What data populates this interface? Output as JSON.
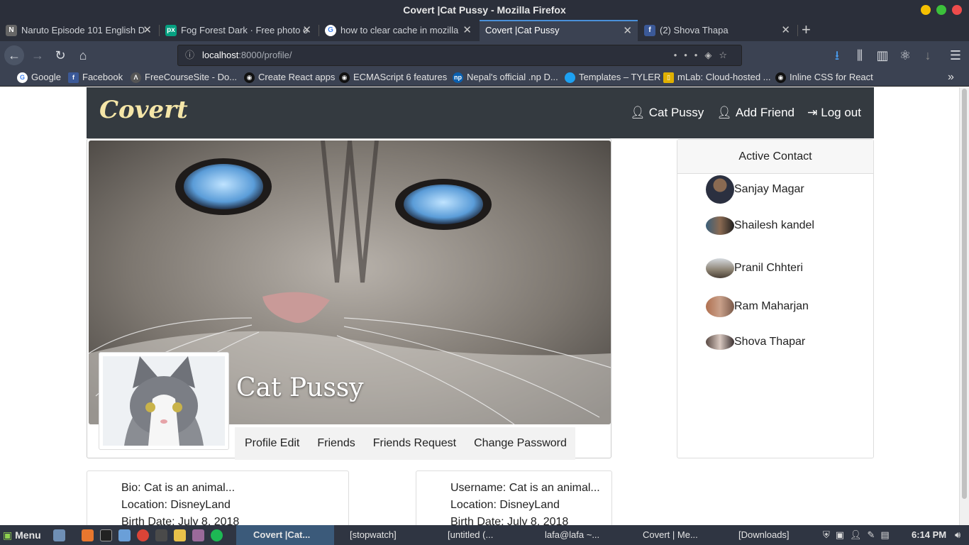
{
  "window": {
    "title": "Covert |Cat Pussy - Mozilla Firefox"
  },
  "tabs": [
    {
      "label": "Naruto Episode 101 English D",
      "icon": "N"
    },
    {
      "label": "Fog Forest Dark · Free photo o",
      "icon": "px"
    },
    {
      "label": "how to clear cache in mozilla",
      "icon": "G"
    },
    {
      "label": "Covert |Cat Pussy",
      "icon": ""
    },
    {
      "label": "(2) Shova Thapa",
      "icon": "f"
    }
  ],
  "url": {
    "host": "localhost",
    "rest": ":8000/profile/"
  },
  "bookmarks": [
    "Google",
    "Facebook",
    "FreeCourseSite - Do...",
    "Create React apps",
    "ECMAScript 6 features",
    "Nepal's official .np D...",
    "Templates – TYLER",
    "mLab: Cloud-hosted ...",
    "Inline CSS for React"
  ],
  "site": {
    "brand": "Covert",
    "nav": {
      "profile": "Cat Pussy",
      "add_friend": "Add Friend",
      "logout": "Log out"
    },
    "profile_name": "Cat Pussy",
    "profile_tabs": [
      "Profile Edit",
      "Friends",
      "Friends Request",
      "Change Password"
    ],
    "contacts_title": "Active Contact",
    "contacts": [
      "Sanjay Magar",
      "Shailesh kandel",
      "Pranil Chhteri",
      "Ram Maharjan",
      "Shova Thapar"
    ],
    "info_left": {
      "bio": "Bio: Cat is an animal...",
      "location": "Location: DisneyLand",
      "birth": "Birth Date: July 8, 2018"
    },
    "info_right": {
      "username": "Username: Cat is an animal...",
      "location": "Location: DisneyLand",
      "birth": "Birth Date: July 8, 2018"
    }
  },
  "taskbar": {
    "menu": "Menu",
    "windows": [
      "Covert |Cat...",
      "[stopwatch]",
      "[untitled (...",
      "lafa@lafa ~...",
      "Covert | Me...",
      "[Downloads]"
    ],
    "clock": "6:14 PM"
  },
  "colors": {
    "site_nav": "#343a40",
    "brand": "#f5e6a8",
    "tab_accent": "#4a90d9"
  }
}
